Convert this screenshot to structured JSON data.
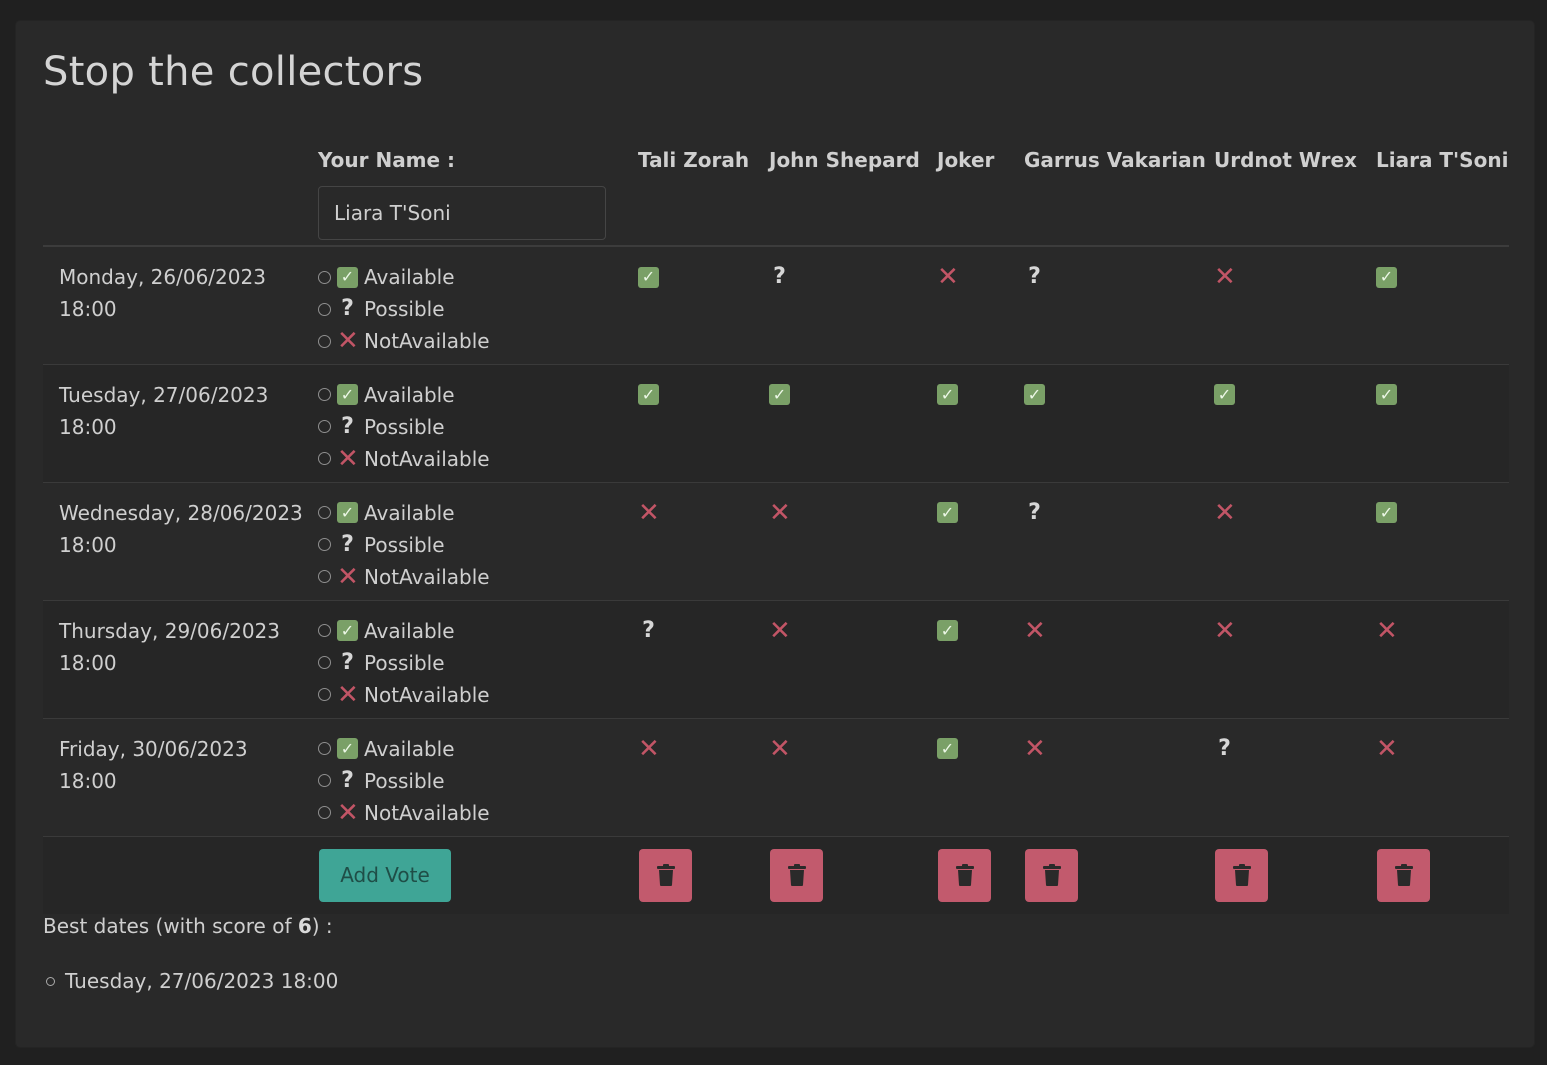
{
  "title": "Stop the collectors",
  "header": {
    "your_name_label": "Your Name :",
    "name_input_value": "Liara T'Soni",
    "participants": [
      "Tali Zorah",
      "John Shepard",
      "Joker",
      "Garrus Vakarian",
      "Urdnot Wrex",
      "Liara T'Soni"
    ]
  },
  "options": {
    "available": "Available",
    "possible": "Possible",
    "not_available": "NotAvailable"
  },
  "dates": [
    {
      "day": "Monday, 26/06/2023",
      "time": "18:00",
      "votes": [
        "yes",
        "maybe",
        "no",
        "maybe",
        "no",
        "yes"
      ]
    },
    {
      "day": "Tuesday, 27/06/2023",
      "time": "18:00",
      "votes": [
        "yes",
        "yes",
        "yes",
        "yes",
        "yes",
        "yes"
      ]
    },
    {
      "day": "Wednesday, 28/06/2023",
      "time": "18:00",
      "votes": [
        "no",
        "no",
        "yes",
        "maybe",
        "no",
        "yes"
      ]
    },
    {
      "day": "Thursday, 29/06/2023",
      "time": "18:00",
      "votes": [
        "maybe",
        "no",
        "yes",
        "no",
        "no",
        "no"
      ]
    },
    {
      "day": "Friday, 30/06/2023",
      "time": "18:00",
      "votes": [
        "no",
        "no",
        "yes",
        "no",
        "maybe",
        "no"
      ]
    }
  ],
  "add_vote_label": "Add Vote",
  "best": {
    "prefix": "Best dates (with score of ",
    "score": "6",
    "suffix": ") :",
    "dates": [
      "Tuesday, 27/06/2023 18:00"
    ]
  },
  "colors": {
    "available": "#7aa067",
    "not_available": "#c25566",
    "accent": "#3fa596",
    "delete": "#c25a6d"
  }
}
